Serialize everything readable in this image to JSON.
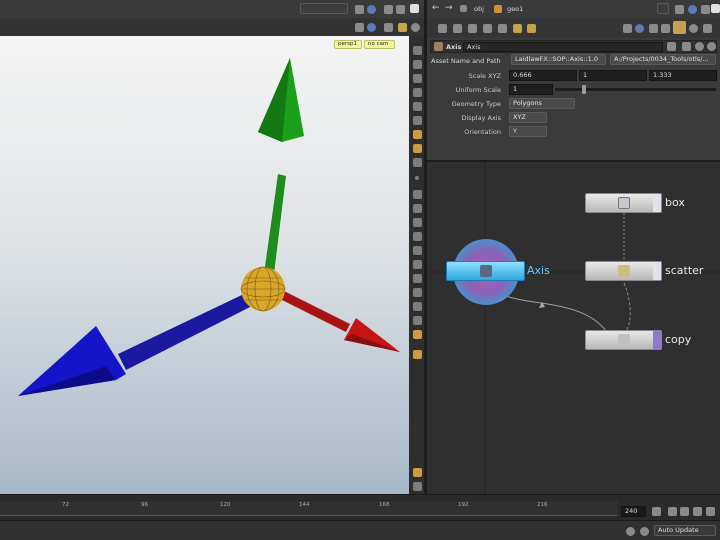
{
  "viewport": {
    "view_label": "persp1",
    "cam_label": "no cam"
  },
  "network": {
    "path_obj": "obj",
    "path_geo": "geo1"
  },
  "params": {
    "node_type": "Axis",
    "node_name": "Axis",
    "asset_label": "Asset Name and Path",
    "asset_name": "LaidlawFX::SOP::Axis::1.0",
    "asset_path": "A:/Projects/0034_Tools/otls/...",
    "scale_label": "Scale XYZ",
    "scale_x": "0.666",
    "scale_y": "1",
    "scale_z": "1.333",
    "uniform_label": "Uniform Scale",
    "uniform_value": "1",
    "uniform_fraction": 0.17,
    "geotype_label": "Geometry Type",
    "geotype_value": "Polygons",
    "display_label": "Display Axis",
    "display_value": "XYZ",
    "orient_label": "Orientation",
    "orient_value": "Y"
  },
  "nodes": [
    {
      "name": "box"
    },
    {
      "name": "scatter"
    },
    {
      "name": "copy"
    },
    {
      "name": "Axis"
    }
  ],
  "timeline": {
    "ticks": [
      "72",
      "96",
      "120",
      "144",
      "168",
      "192",
      "216"
    ],
    "end_frame": "240",
    "update_mode": "Auto Update"
  },
  "colors": {
    "axis_x": "#c41414",
    "axis_y": "#1aa01a",
    "axis_z": "#1414c8",
    "center": "#d8a62a",
    "selected_node": "#2fa8e0",
    "display_flag": "#8e7ad0",
    "viewport_top": "#f4f4f4",
    "viewport_bottom": "#a8b8c8"
  }
}
